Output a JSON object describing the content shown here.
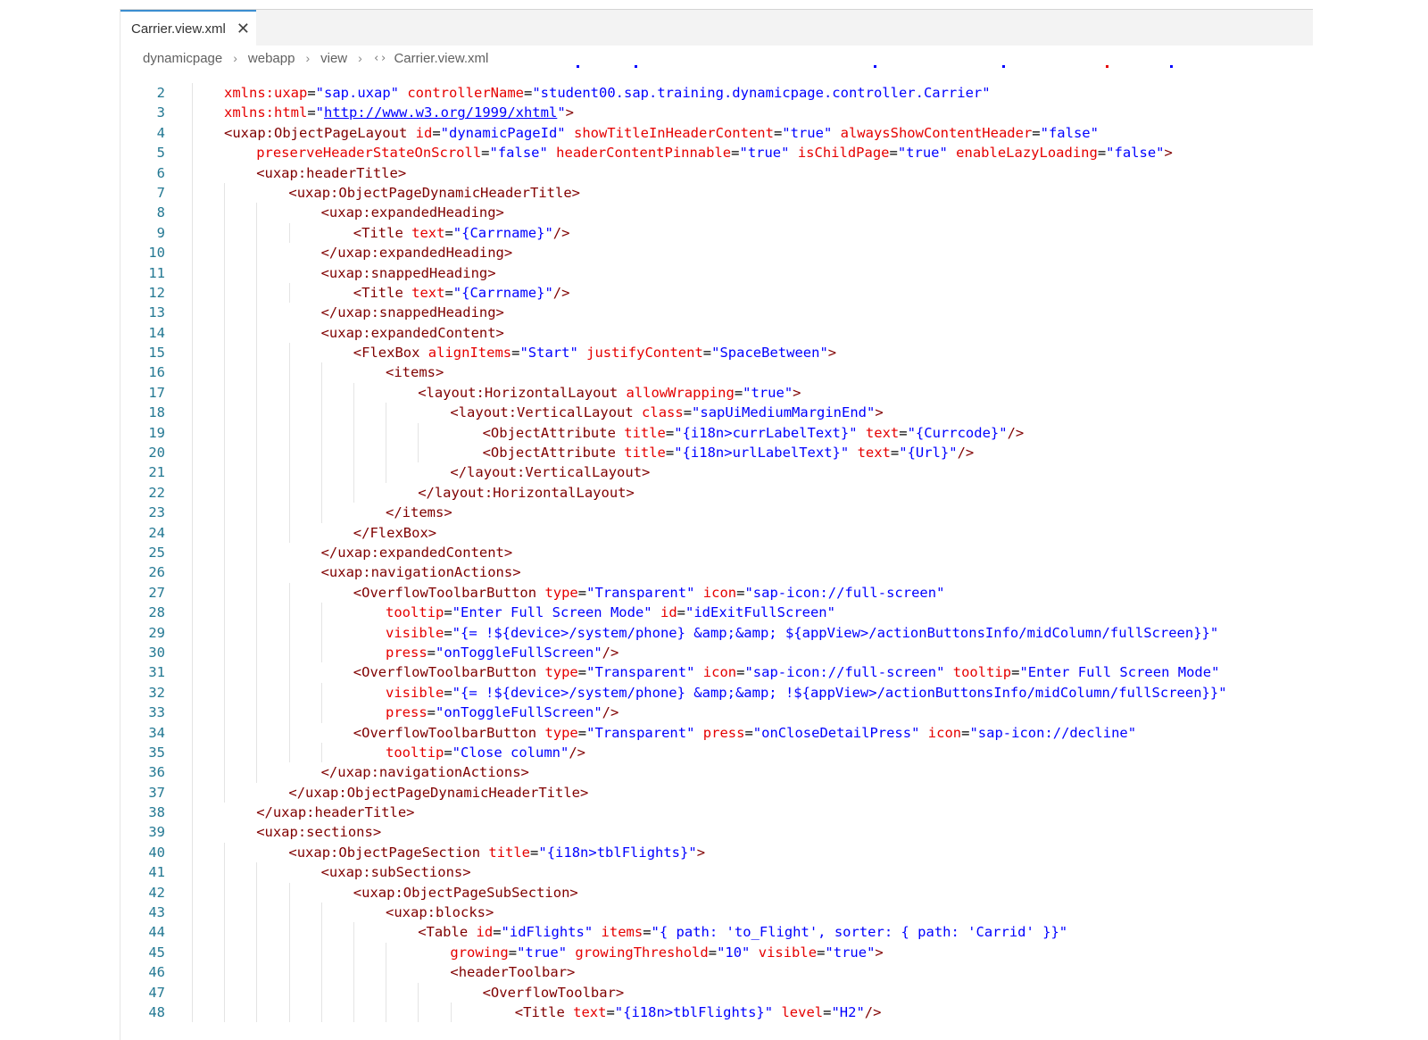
{
  "tab": {
    "title": "Carrier.view.xml",
    "close_icon": "close-icon"
  },
  "breadcrumb": {
    "items": [
      "dynamicpage",
      "webapp",
      "view",
      "Carrier.view.xml"
    ],
    "file_icon": "xml-brackets-icon"
  },
  "colors": {
    "tag": "#800000",
    "attribute": "#e50000",
    "string": "#0000ff",
    "line_number": "#237893",
    "tab_accent": "#3b8ed0"
  },
  "code_lines": [
    {
      "n": 2,
      "indent": 1,
      "tokens": [
        [
          "attr",
          "xmlns:uxap"
        ],
        [
          "eq",
          "="
        ],
        [
          "str",
          "\"sap.uxap\""
        ],
        [
          "eq",
          " "
        ],
        [
          "attr",
          "controllerName"
        ],
        [
          "eq",
          "="
        ],
        [
          "str",
          "\"student00.sap.training.dynamicpage.controller.Carrier\""
        ]
      ]
    },
    {
      "n": 3,
      "indent": 1,
      "tokens": [
        [
          "attr",
          "xmlns:html"
        ],
        [
          "eq",
          "="
        ],
        [
          "str",
          "\""
        ],
        [
          "link",
          "http://www.w3.org/1999/xhtml"
        ],
        [
          "str",
          "\""
        ],
        [
          "tag",
          ">"
        ]
      ]
    },
    {
      "n": 4,
      "indent": 1,
      "tokens": [
        [
          "tag",
          "<uxap:ObjectPageLayout "
        ],
        [
          "attr",
          "id"
        ],
        [
          "eq",
          "="
        ],
        [
          "str",
          "\"dynamicPageId\""
        ],
        [
          "eq",
          " "
        ],
        [
          "attr",
          "showTitleInHeaderContent"
        ],
        [
          "eq",
          "="
        ],
        [
          "str",
          "\"true\""
        ],
        [
          "eq",
          " "
        ],
        [
          "attr",
          "alwaysShowContentHeader"
        ],
        [
          "eq",
          "="
        ],
        [
          "str",
          "\"false\""
        ]
      ]
    },
    {
      "n": 5,
      "indent": 2,
      "tokens": [
        [
          "attr",
          "preserveHeaderStateOnScroll"
        ],
        [
          "eq",
          "="
        ],
        [
          "str",
          "\"false\""
        ],
        [
          "eq",
          " "
        ],
        [
          "attr",
          "headerContentPinnable"
        ],
        [
          "eq",
          "="
        ],
        [
          "str",
          "\"true\""
        ],
        [
          "eq",
          " "
        ],
        [
          "attr",
          "isChildPage"
        ],
        [
          "eq",
          "="
        ],
        [
          "str",
          "\"true\""
        ],
        [
          "eq",
          " "
        ],
        [
          "attr",
          "enableLazyLoading"
        ],
        [
          "eq",
          "="
        ],
        [
          "str",
          "\"false\""
        ],
        [
          "tag",
          ">"
        ]
      ]
    },
    {
      "n": 6,
      "indent": 2,
      "tokens": [
        [
          "tag",
          "<uxap:headerTitle>"
        ]
      ]
    },
    {
      "n": 7,
      "indent": 3,
      "tokens": [
        [
          "tag",
          "<uxap:ObjectPageDynamicHeaderTitle>"
        ]
      ]
    },
    {
      "n": 8,
      "indent": 4,
      "tokens": [
        [
          "tag",
          "<uxap:expandedHeading>"
        ]
      ]
    },
    {
      "n": 9,
      "indent": 5,
      "tokens": [
        [
          "tag",
          "<Title "
        ],
        [
          "attr",
          "text"
        ],
        [
          "eq",
          "="
        ],
        [
          "str",
          "\"{Carrname}\""
        ],
        [
          "tag",
          "/>"
        ]
      ]
    },
    {
      "n": 10,
      "indent": 4,
      "tokens": [
        [
          "tag",
          "</uxap:expandedHeading>"
        ]
      ]
    },
    {
      "n": 11,
      "indent": 4,
      "tokens": [
        [
          "tag",
          "<uxap:snappedHeading>"
        ]
      ]
    },
    {
      "n": 12,
      "indent": 5,
      "tokens": [
        [
          "tag",
          "<Title "
        ],
        [
          "attr",
          "text"
        ],
        [
          "eq",
          "="
        ],
        [
          "str",
          "\"{Carrname}\""
        ],
        [
          "tag",
          "/>"
        ]
      ]
    },
    {
      "n": 13,
      "indent": 4,
      "tokens": [
        [
          "tag",
          "</uxap:snappedHeading>"
        ]
      ]
    },
    {
      "n": 14,
      "indent": 4,
      "tokens": [
        [
          "tag",
          "<uxap:expandedContent>"
        ]
      ]
    },
    {
      "n": 15,
      "indent": 5,
      "tokens": [
        [
          "tag",
          "<FlexBox "
        ],
        [
          "attr",
          "alignItems"
        ],
        [
          "eq",
          "="
        ],
        [
          "str",
          "\"Start\""
        ],
        [
          "eq",
          " "
        ],
        [
          "attr",
          "justifyContent"
        ],
        [
          "eq",
          "="
        ],
        [
          "str",
          "\"SpaceBetween\""
        ],
        [
          "tag",
          ">"
        ]
      ]
    },
    {
      "n": 16,
      "indent": 6,
      "tokens": [
        [
          "tag",
          "<items>"
        ]
      ]
    },
    {
      "n": 17,
      "indent": 7,
      "tokens": [
        [
          "tag",
          "<layout:HorizontalLayout "
        ],
        [
          "attr",
          "allowWrapping"
        ],
        [
          "eq",
          "="
        ],
        [
          "str",
          "\"true\""
        ],
        [
          "tag",
          ">"
        ]
      ]
    },
    {
      "n": 18,
      "indent": 8,
      "tokens": [
        [
          "tag",
          "<layout:VerticalLayout "
        ],
        [
          "attr",
          "class"
        ],
        [
          "eq",
          "="
        ],
        [
          "str",
          "\"sapUiMediumMarginEnd\""
        ],
        [
          "tag",
          ">"
        ]
      ]
    },
    {
      "n": 19,
      "indent": 9,
      "tokens": [
        [
          "tag",
          "<ObjectAttribute "
        ],
        [
          "attr",
          "title"
        ],
        [
          "eq",
          "="
        ],
        [
          "str",
          "\"{i18n>currLabelText}\""
        ],
        [
          "eq",
          " "
        ],
        [
          "attr",
          "text"
        ],
        [
          "eq",
          "="
        ],
        [
          "str",
          "\"{Currcode}\""
        ],
        [
          "tag",
          "/>"
        ]
      ]
    },
    {
      "n": 20,
      "indent": 9,
      "tokens": [
        [
          "tag",
          "<ObjectAttribute "
        ],
        [
          "attr",
          "title"
        ],
        [
          "eq",
          "="
        ],
        [
          "str",
          "\"{i18n>urlLabelText}\""
        ],
        [
          "eq",
          " "
        ],
        [
          "attr",
          "text"
        ],
        [
          "eq",
          "="
        ],
        [
          "str",
          "\"{Url}\""
        ],
        [
          "tag",
          "/>"
        ]
      ]
    },
    {
      "n": 21,
      "indent": 8,
      "tokens": [
        [
          "tag",
          "</layout:VerticalLayout>"
        ]
      ]
    },
    {
      "n": 22,
      "indent": 7,
      "tokens": [
        [
          "tag",
          "</layout:HorizontalLayout>"
        ]
      ]
    },
    {
      "n": 23,
      "indent": 6,
      "tokens": [
        [
          "tag",
          "</items>"
        ]
      ]
    },
    {
      "n": 24,
      "indent": 5,
      "tokens": [
        [
          "tag",
          "</FlexBox>"
        ]
      ]
    },
    {
      "n": 25,
      "indent": 4,
      "tokens": [
        [
          "tag",
          "</uxap:expandedContent>"
        ]
      ]
    },
    {
      "n": 26,
      "indent": 4,
      "tokens": [
        [
          "tag",
          "<uxap:navigationActions>"
        ]
      ]
    },
    {
      "n": 27,
      "indent": 5,
      "tokens": [
        [
          "tag",
          "<OverflowToolbarButton "
        ],
        [
          "attr",
          "type"
        ],
        [
          "eq",
          "="
        ],
        [
          "str",
          "\"Transparent\""
        ],
        [
          "eq",
          " "
        ],
        [
          "attr",
          "icon"
        ],
        [
          "eq",
          "="
        ],
        [
          "str",
          "\"sap-icon://full-screen\""
        ]
      ]
    },
    {
      "n": 28,
      "indent": 6,
      "tokens": [
        [
          "attr",
          "tooltip"
        ],
        [
          "eq",
          "="
        ],
        [
          "str",
          "\"Enter Full Screen Mode\""
        ],
        [
          "eq",
          " "
        ],
        [
          "attr",
          "id"
        ],
        [
          "eq",
          "="
        ],
        [
          "str",
          "\"idExitFullScreen\""
        ]
      ]
    },
    {
      "n": 29,
      "indent": 6,
      "tokens": [
        [
          "attr",
          "visible"
        ],
        [
          "eq",
          "="
        ],
        [
          "str",
          "\"{= !${device>/system/phone} &amp;&amp; ${appView>/actionButtonsInfo/midColumn/fullScreen}}\""
        ]
      ]
    },
    {
      "n": 30,
      "indent": 6,
      "tokens": [
        [
          "attr",
          "press"
        ],
        [
          "eq",
          "="
        ],
        [
          "str",
          "\"onToggleFullScreen\""
        ],
        [
          "tag",
          "/>"
        ]
      ]
    },
    {
      "n": 31,
      "indent": 5,
      "tokens": [
        [
          "tag",
          "<OverflowToolbarButton "
        ],
        [
          "attr",
          "type"
        ],
        [
          "eq",
          "="
        ],
        [
          "str",
          "\"Transparent\""
        ],
        [
          "eq",
          " "
        ],
        [
          "attr",
          "icon"
        ],
        [
          "eq",
          "="
        ],
        [
          "str",
          "\"sap-icon://full-screen\""
        ],
        [
          "eq",
          " "
        ],
        [
          "attr",
          "tooltip"
        ],
        [
          "eq",
          "="
        ],
        [
          "str",
          "\"Enter Full Screen Mode\""
        ]
      ]
    },
    {
      "n": 32,
      "indent": 6,
      "tokens": [
        [
          "attr",
          "visible"
        ],
        [
          "eq",
          "="
        ],
        [
          "str",
          "\"{= !${device>/system/phone} &amp;&amp; !${appView>/actionButtonsInfo/midColumn/fullScreen}}\""
        ]
      ]
    },
    {
      "n": 33,
      "indent": 6,
      "tokens": [
        [
          "attr",
          "press"
        ],
        [
          "eq",
          "="
        ],
        [
          "str",
          "\"onToggleFullScreen\""
        ],
        [
          "tag",
          "/>"
        ]
      ]
    },
    {
      "n": 34,
      "indent": 5,
      "tokens": [
        [
          "tag",
          "<OverflowToolbarButton "
        ],
        [
          "attr",
          "type"
        ],
        [
          "eq",
          "="
        ],
        [
          "str",
          "\"Transparent\""
        ],
        [
          "eq",
          " "
        ],
        [
          "attr",
          "press"
        ],
        [
          "eq",
          "="
        ],
        [
          "str",
          "\"onCloseDetailPress\""
        ],
        [
          "eq",
          " "
        ],
        [
          "attr",
          "icon"
        ],
        [
          "eq",
          "="
        ],
        [
          "str",
          "\"sap-icon://decline\""
        ]
      ]
    },
    {
      "n": 35,
      "indent": 6,
      "tokens": [
        [
          "attr",
          "tooltip"
        ],
        [
          "eq",
          "="
        ],
        [
          "str",
          "\"Close column\""
        ],
        [
          "tag",
          "/>"
        ]
      ]
    },
    {
      "n": 36,
      "indent": 4,
      "tokens": [
        [
          "tag",
          "</uxap:navigationActions>"
        ]
      ]
    },
    {
      "n": 37,
      "indent": 3,
      "tokens": [
        [
          "tag",
          "</uxap:ObjectPageDynamicHeaderTitle>"
        ]
      ]
    },
    {
      "n": 38,
      "indent": 2,
      "tokens": [
        [
          "tag",
          "</uxap:headerTitle>"
        ]
      ]
    },
    {
      "n": 39,
      "indent": 2,
      "tokens": [
        [
          "tag",
          "<uxap:sections>"
        ]
      ]
    },
    {
      "n": 40,
      "indent": 3,
      "tokens": [
        [
          "tag",
          "<uxap:ObjectPageSection "
        ],
        [
          "attr",
          "title"
        ],
        [
          "eq",
          "="
        ],
        [
          "str",
          "\"{i18n>tblFlights}\""
        ],
        [
          "tag",
          ">"
        ]
      ]
    },
    {
      "n": 41,
      "indent": 4,
      "tokens": [
        [
          "tag",
          "<uxap:subSections>"
        ]
      ]
    },
    {
      "n": 42,
      "indent": 5,
      "tokens": [
        [
          "tag",
          "<uxap:ObjectPageSubSection>"
        ]
      ]
    },
    {
      "n": 43,
      "indent": 6,
      "tokens": [
        [
          "tag",
          "<uxap:blocks>"
        ]
      ]
    },
    {
      "n": 44,
      "indent": 7,
      "tokens": [
        [
          "tag",
          "<Table "
        ],
        [
          "attr",
          "id"
        ],
        [
          "eq",
          "="
        ],
        [
          "str",
          "\"idFlights\""
        ],
        [
          "eq",
          " "
        ],
        [
          "attr",
          "items"
        ],
        [
          "eq",
          "="
        ],
        [
          "str",
          "\"{ path: 'to_Flight', sorter: { path: 'Carrid' }}\""
        ]
      ]
    },
    {
      "n": 45,
      "indent": 8,
      "tokens": [
        [
          "attr",
          "growing"
        ],
        [
          "eq",
          "="
        ],
        [
          "str",
          "\"true\""
        ],
        [
          "eq",
          " "
        ],
        [
          "attr",
          "growingThreshold"
        ],
        [
          "eq",
          "="
        ],
        [
          "str",
          "\"10\""
        ],
        [
          "eq",
          " "
        ],
        [
          "attr",
          "visible"
        ],
        [
          "eq",
          "="
        ],
        [
          "str",
          "\"true\""
        ],
        [
          "tag",
          ">"
        ]
      ]
    },
    {
      "n": 46,
      "indent": 8,
      "tokens": [
        [
          "tag",
          "<headerToolbar>"
        ]
      ]
    },
    {
      "n": 47,
      "indent": 9,
      "tokens": [
        [
          "tag",
          "<OverflowToolbar>"
        ]
      ]
    },
    {
      "n": 48,
      "indent": 10,
      "tokens": [
        [
          "tag",
          "<Title "
        ],
        [
          "attr",
          "text"
        ],
        [
          "eq",
          "="
        ],
        [
          "str",
          "\"{i18n>tblFlights}\""
        ],
        [
          "eq",
          " "
        ],
        [
          "attr",
          "level"
        ],
        [
          "eq",
          "="
        ],
        [
          "str",
          "\"H2\""
        ],
        [
          "tag",
          "/>"
        ]
      ]
    }
  ]
}
